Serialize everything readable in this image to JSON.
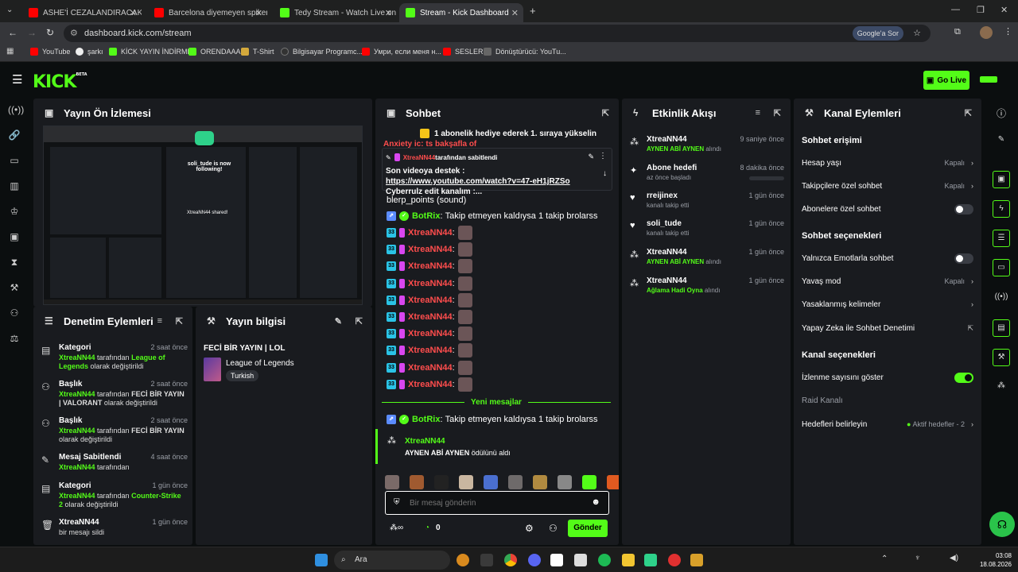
{
  "browser": {
    "tabs": [
      {
        "label": "ASHE'İ CEZALANDIRACAKMIŞ 😂",
        "color": "#ff0000"
      },
      {
        "label": "Barcelona diyemeyen spikerin d",
        "color": "#ff0000"
      },
      {
        "label": "Tedy Stream - Watch Live on Ki",
        "color": "#53fc18"
      },
      {
        "label": "Stream - Kick Dashboard",
        "color": "#53fc18"
      }
    ],
    "url": "dashboard.kick.com/stream",
    "ask_google": "Google'a Sor",
    "bookmarks": [
      "YouTube",
      "şarkı",
      "KİCK YAYIN İNDİRME",
      "ORENDAAA",
      "T-Shirt",
      "Bilgisayar Programc...",
      "Умри, если меня н...",
      "SESLER",
      "Dönüştürücü: YouTu..."
    ]
  },
  "kick": {
    "logo": "KICK",
    "beta": "BETA",
    "go_live": "Go Live"
  },
  "preview": {
    "title": "Yayın Ön İzlemesi",
    "overlay": "soli_tude is now following!",
    "overlay2": "XtreaNN44 shared!"
  },
  "mod_actions": {
    "title": "Denetim Eylemleri",
    "items": [
      {
        "title": "Kategori",
        "time": "2 saat önce",
        "user": "XtreaNN44",
        "mid": " tarafından ",
        "value": "League of Legends",
        "suffix": " olarak değiştirildi"
      },
      {
        "title": "Başlık",
        "time": "2 saat önce",
        "user": "XtreaNN44",
        "mid": " tarafından ",
        "value": "FECİ BİR YAYIN | VALORANT",
        "suffix": " olarak değiştirildi"
      },
      {
        "title": "Başlık",
        "time": "2 saat önce",
        "user": "XtreaNN44",
        "mid": " tarafından ",
        "value": "FECİ BİR YAYIN",
        "suffix": " olarak değiştirildi"
      },
      {
        "title": "Mesaj Sabitlendi",
        "time": "4 saat önce",
        "user": "XtreaNN44",
        "mid": " tarafından",
        "value": "",
        "suffix": ""
      },
      {
        "title": "Kategori",
        "time": "1 gün önce",
        "user": "XtreaNN44",
        "mid": " tarafından ",
        "value": "Counter-Strike 2",
        "suffix": " olarak değiştirildi"
      },
      {
        "title": "XtreaNN44",
        "time": "1 gün önce",
        "user": "",
        "mid": "bir mesajı sildi",
        "value": "",
        "suffix": ""
      }
    ]
  },
  "stream_info": {
    "title": "Yayın bilgisi",
    "stream_title": "FECİ BİR YAYIN | LOL",
    "category": "League of Legends",
    "language": "Turkish"
  },
  "chat": {
    "title": "Sohbet",
    "gift_banner": "1 abonelik hediye ederek 1. sıraya yükselin",
    "behind_text": "Anxiety ic: ts bakşafla of",
    "pinned_by_user": "XtreaNN44",
    "pinned_by_text": " tarafından sabitlendi",
    "pinned_prefix": "Son videoya destek : ",
    "pinned_link": "https://www.youtube.com/watch?v=47-eH1jRZSo",
    "pinned_suffix": " Cyberrulz edit kanalım :...",
    "points_line": "blerp_points (sound)",
    "bot_name": "BotRix",
    "bot_msg": "Takip etmeyen kaldıysa 1 takip brolarss",
    "repeat_user": "XtreaNN44",
    "repeat_count": 10,
    "new_messages": "Yeni mesajlar",
    "reward_user": "XtreaNN44",
    "reward_name": "AYNEN ABİ AYNEN",
    "reward_suffix": " ödülünü aldı",
    "input_placeholder": "Bir mesaj gönderin",
    "points": "0",
    "send": "Gönder"
  },
  "activity": {
    "title": "Etkinlik Akışı",
    "items": [
      {
        "icon": "kick-points-icon",
        "name": "XtreaNN44",
        "time": "9 saniye önce",
        "detail": "AYNEN ABİ AYNEN",
        "detail2": " alındı",
        "green": true
      },
      {
        "icon": "sparkle-icon",
        "name": "Abone hedefi",
        "time": "8 dakika önce",
        "detail": "az önce başladı",
        "detail2": "",
        "green": false
      },
      {
        "icon": "heart-icon",
        "name": "rreijinex",
        "time": "1 gün önce",
        "detail": "kanalı takip etti",
        "detail2": "",
        "green": false
      },
      {
        "icon": "heart-icon",
        "name": "soli_tude",
        "time": "1 gün önce",
        "detail": "kanalı takip etti",
        "detail2": "",
        "green": false
      },
      {
        "icon": "kick-points-icon",
        "name": "XtreaNN44",
        "time": "1 gün önce",
        "detail": "AYNEN ABİ AYNEN",
        "detail2": " alındı",
        "green": true
      },
      {
        "icon": "kick-points-icon",
        "name": "XtreaNN44",
        "time": "1 gün önce",
        "detail": "Ağlama Hadi Oyna",
        "detail2": " alındı",
        "green": true
      }
    ]
  },
  "channel_actions": {
    "title": "Kanal Eylemleri",
    "chat_access": "Sohbet erişimi",
    "account_age": "Hesap yaşı",
    "account_age_val": "Kapalı",
    "followers_only": "Takipçilere özel sohbet",
    "followers_only_val": "Kapalı",
    "subs_only": "Abonelere özel sohbet",
    "chat_options": "Sohbet seçenekleri",
    "emote_only": "Yalnızca Emotlarla sohbet",
    "slow_mode": "Yavaş mod",
    "slow_mode_val": "Kapalı",
    "banned_words": "Yasaklanmış kelimeler",
    "ai_moderation": "Yapay Zeka ile Sohbet Denetimi",
    "channel_options": "Kanal seçenekleri",
    "show_viewers": "İzlenme sayısını göster",
    "raid_channel": "Raid Kanalı",
    "set_goals": "Hedefleri belirleyin",
    "active_goals": "Aktif hedefler - 2"
  },
  "taskbar": {
    "search": "Ara",
    "time": "03:08",
    "date": "18.08.2026"
  }
}
